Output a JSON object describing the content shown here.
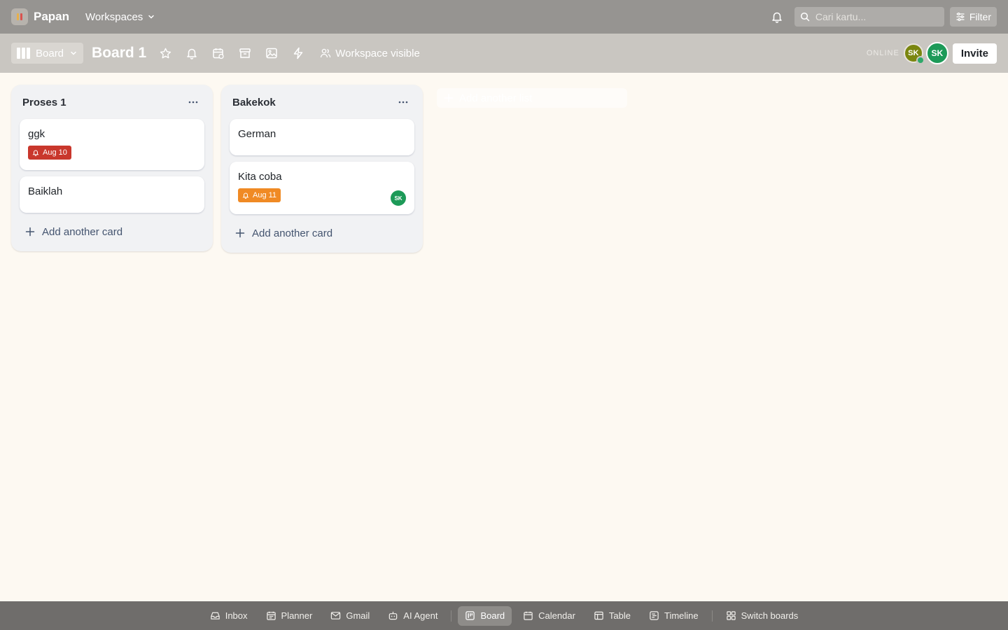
{
  "app": {
    "name": "Papan",
    "workspaces_label": "Workspaces"
  },
  "topbar": {
    "search_placeholder": "Cari kartu...",
    "filter_label": "Filter"
  },
  "board": {
    "view_label": "Board",
    "title": "Board 1",
    "visibility_label": "Workspace visible",
    "online_label": "ONLINE",
    "members": [
      {
        "initials": "SK",
        "color": "#7a860f"
      },
      {
        "initials": "SK",
        "color": "#1d9a58"
      }
    ],
    "invite_label": "Invite"
  },
  "lists": [
    {
      "title": "Proses 1",
      "cards": [
        {
          "title": "ggk",
          "due": "Aug 10",
          "due_color": "#c9372c"
        },
        {
          "title": "Baiklah"
        }
      ],
      "add_card_label": "Add another card"
    },
    {
      "title": "Bakekok",
      "cards": [
        {
          "title": "German"
        },
        {
          "title": "Kita coba",
          "due": "Aug 11",
          "due_color": "#f08a24",
          "member": "SK"
        }
      ],
      "add_card_label": "Add another card"
    }
  ],
  "add_list_label": "Add another list",
  "bottom_nav": {
    "items": [
      {
        "label": "Inbox",
        "icon": "inbox-icon"
      },
      {
        "label": "Planner",
        "icon": "planner-icon"
      },
      {
        "label": "Gmail",
        "icon": "mail-icon"
      },
      {
        "label": "AI Agent",
        "icon": "robot-icon"
      },
      {
        "label": "Board",
        "icon": "board-icon",
        "active": true
      },
      {
        "label": "Calendar",
        "icon": "calendar-icon"
      },
      {
        "label": "Table",
        "icon": "table-icon"
      },
      {
        "label": "Timeline",
        "icon": "timeline-icon"
      }
    ],
    "switch_label": "Switch boards"
  },
  "colors": {
    "topbar": "#969491",
    "boardbar": "#c9c6c1",
    "canvas": "#fdf9f2",
    "bottombar": "#6f6d6b"
  }
}
